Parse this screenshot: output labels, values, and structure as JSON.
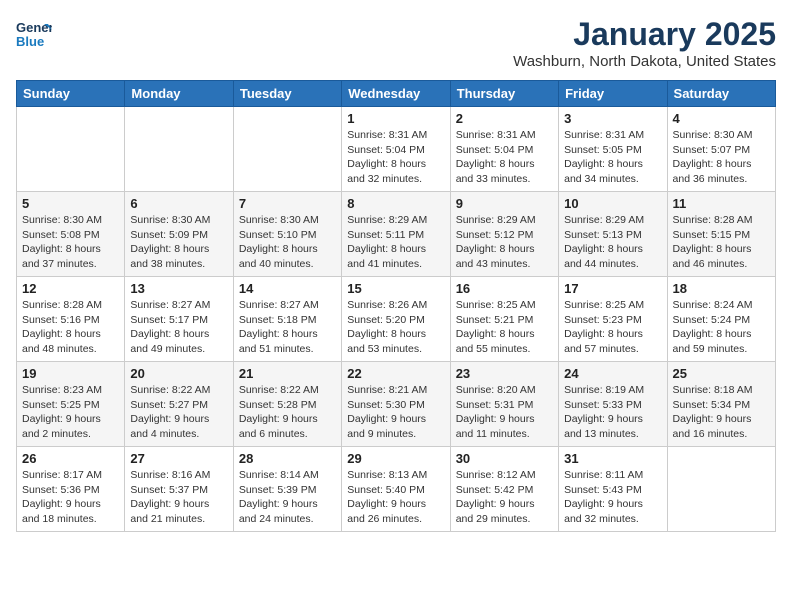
{
  "header": {
    "logo_line1": "General",
    "logo_line2": "Blue",
    "title": "January 2025",
    "subtitle": "Washburn, North Dakota, United States"
  },
  "weekdays": [
    "Sunday",
    "Monday",
    "Tuesday",
    "Wednesday",
    "Thursday",
    "Friday",
    "Saturday"
  ],
  "weeks": [
    [
      {
        "day": "",
        "info": ""
      },
      {
        "day": "",
        "info": ""
      },
      {
        "day": "",
        "info": ""
      },
      {
        "day": "1",
        "info": "Sunrise: 8:31 AM\nSunset: 5:04 PM\nDaylight: 8 hours and 32 minutes."
      },
      {
        "day": "2",
        "info": "Sunrise: 8:31 AM\nSunset: 5:04 PM\nDaylight: 8 hours and 33 minutes."
      },
      {
        "day": "3",
        "info": "Sunrise: 8:31 AM\nSunset: 5:05 PM\nDaylight: 8 hours and 34 minutes."
      },
      {
        "day": "4",
        "info": "Sunrise: 8:30 AM\nSunset: 5:07 PM\nDaylight: 8 hours and 36 minutes."
      }
    ],
    [
      {
        "day": "5",
        "info": "Sunrise: 8:30 AM\nSunset: 5:08 PM\nDaylight: 8 hours and 37 minutes."
      },
      {
        "day": "6",
        "info": "Sunrise: 8:30 AM\nSunset: 5:09 PM\nDaylight: 8 hours and 38 minutes."
      },
      {
        "day": "7",
        "info": "Sunrise: 8:30 AM\nSunset: 5:10 PM\nDaylight: 8 hours and 40 minutes."
      },
      {
        "day": "8",
        "info": "Sunrise: 8:29 AM\nSunset: 5:11 PM\nDaylight: 8 hours and 41 minutes."
      },
      {
        "day": "9",
        "info": "Sunrise: 8:29 AM\nSunset: 5:12 PM\nDaylight: 8 hours and 43 minutes."
      },
      {
        "day": "10",
        "info": "Sunrise: 8:29 AM\nSunset: 5:13 PM\nDaylight: 8 hours and 44 minutes."
      },
      {
        "day": "11",
        "info": "Sunrise: 8:28 AM\nSunset: 5:15 PM\nDaylight: 8 hours and 46 minutes."
      }
    ],
    [
      {
        "day": "12",
        "info": "Sunrise: 8:28 AM\nSunset: 5:16 PM\nDaylight: 8 hours and 48 minutes."
      },
      {
        "day": "13",
        "info": "Sunrise: 8:27 AM\nSunset: 5:17 PM\nDaylight: 8 hours and 49 minutes."
      },
      {
        "day": "14",
        "info": "Sunrise: 8:27 AM\nSunset: 5:18 PM\nDaylight: 8 hours and 51 minutes."
      },
      {
        "day": "15",
        "info": "Sunrise: 8:26 AM\nSunset: 5:20 PM\nDaylight: 8 hours and 53 minutes."
      },
      {
        "day": "16",
        "info": "Sunrise: 8:25 AM\nSunset: 5:21 PM\nDaylight: 8 hours and 55 minutes."
      },
      {
        "day": "17",
        "info": "Sunrise: 8:25 AM\nSunset: 5:23 PM\nDaylight: 8 hours and 57 minutes."
      },
      {
        "day": "18",
        "info": "Sunrise: 8:24 AM\nSunset: 5:24 PM\nDaylight: 8 hours and 59 minutes."
      }
    ],
    [
      {
        "day": "19",
        "info": "Sunrise: 8:23 AM\nSunset: 5:25 PM\nDaylight: 9 hours and 2 minutes."
      },
      {
        "day": "20",
        "info": "Sunrise: 8:22 AM\nSunset: 5:27 PM\nDaylight: 9 hours and 4 minutes."
      },
      {
        "day": "21",
        "info": "Sunrise: 8:22 AM\nSunset: 5:28 PM\nDaylight: 9 hours and 6 minutes."
      },
      {
        "day": "22",
        "info": "Sunrise: 8:21 AM\nSunset: 5:30 PM\nDaylight: 9 hours and 9 minutes."
      },
      {
        "day": "23",
        "info": "Sunrise: 8:20 AM\nSunset: 5:31 PM\nDaylight: 9 hours and 11 minutes."
      },
      {
        "day": "24",
        "info": "Sunrise: 8:19 AM\nSunset: 5:33 PM\nDaylight: 9 hours and 13 minutes."
      },
      {
        "day": "25",
        "info": "Sunrise: 8:18 AM\nSunset: 5:34 PM\nDaylight: 9 hours and 16 minutes."
      }
    ],
    [
      {
        "day": "26",
        "info": "Sunrise: 8:17 AM\nSunset: 5:36 PM\nDaylight: 9 hours and 18 minutes."
      },
      {
        "day": "27",
        "info": "Sunrise: 8:16 AM\nSunset: 5:37 PM\nDaylight: 9 hours and 21 minutes."
      },
      {
        "day": "28",
        "info": "Sunrise: 8:14 AM\nSunset: 5:39 PM\nDaylight: 9 hours and 24 minutes."
      },
      {
        "day": "29",
        "info": "Sunrise: 8:13 AM\nSunset: 5:40 PM\nDaylight: 9 hours and 26 minutes."
      },
      {
        "day": "30",
        "info": "Sunrise: 8:12 AM\nSunset: 5:42 PM\nDaylight: 9 hours and 29 minutes."
      },
      {
        "day": "31",
        "info": "Sunrise: 8:11 AM\nSunset: 5:43 PM\nDaylight: 9 hours and 32 minutes."
      },
      {
        "day": "",
        "info": ""
      }
    ]
  ]
}
